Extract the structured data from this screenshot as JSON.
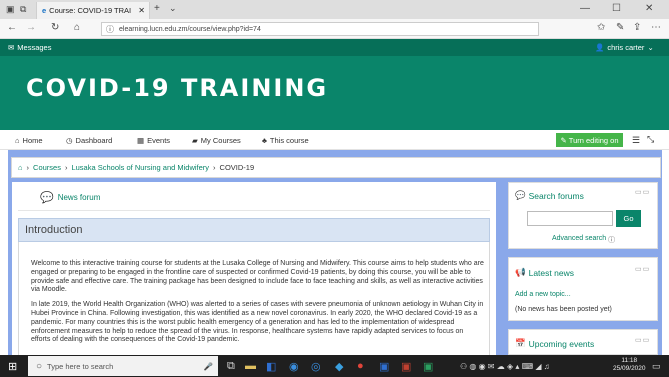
{
  "browser": {
    "tab_title": "Course: COVID-19 TRAI",
    "url": "elearning.lucn.edu.zm/course/view.php?id=74",
    "icons": [
      "back-icon",
      "forward-icon",
      "refresh-icon",
      "home-icon",
      "favorites-icon",
      "reading-list-icon",
      "share-icon",
      "more-icon"
    ]
  },
  "topbar": {
    "messages": "Messages",
    "user": "chris carter"
  },
  "header": {
    "title": "COVID-19 TRAINING"
  },
  "nav": {
    "items": [
      "Home",
      "Dashboard",
      "Events",
      "My Courses",
      "This course"
    ],
    "edit_button": "Turn editing on"
  },
  "breadcrumb": {
    "items": [
      "Courses",
      "Lusaka Schools of Nursing and Midwifery",
      "COVID-19"
    ]
  },
  "main": {
    "news_forum": "News forum",
    "section_title": "Introduction",
    "para1": "Welcome to this interactive training course for students at the Lusaka College of Nursing and Midwifery. This course aims to help students who are engaged or preparing to be engaged in the frontline care of suspected or confirmed Covid-19 patients, by doing this course, you will be able to provide safe and effective care. The training package has been designed to include face to face teaching and skills, as well as interactive activities via Moodle.",
    "para2": "In late 2019, the World Health Organization (WHO) was alerted to a series of cases with severe pneumonia of unknown aetiology in Wuhan City in Hubei Province in China. Following investigation, this was identified as a new novel coronavirus. In early 2020, the WHO declared Covid-19 as a pandemic. For many countries this is the worst public health emergency of a generation and has led to the implementation of widespread enforcement measures to help to reduce the spread of the virus. In response, healthcare systems have rapidly adapted services to focus on efforts of dealing with the consequences of the Covid-19 pandemic."
  },
  "blocks": {
    "search": {
      "title": "Search forums",
      "go": "Go",
      "advanced": "Advanced search"
    },
    "news": {
      "title": "Latest news",
      "add": "Add a new topic...",
      "empty": "(No news has been posted yet)"
    },
    "events": {
      "title": "Upcoming events"
    }
  },
  "taskbar": {
    "search_placeholder": "Type here to search",
    "time": "11:18",
    "date": "25/09/2020"
  }
}
